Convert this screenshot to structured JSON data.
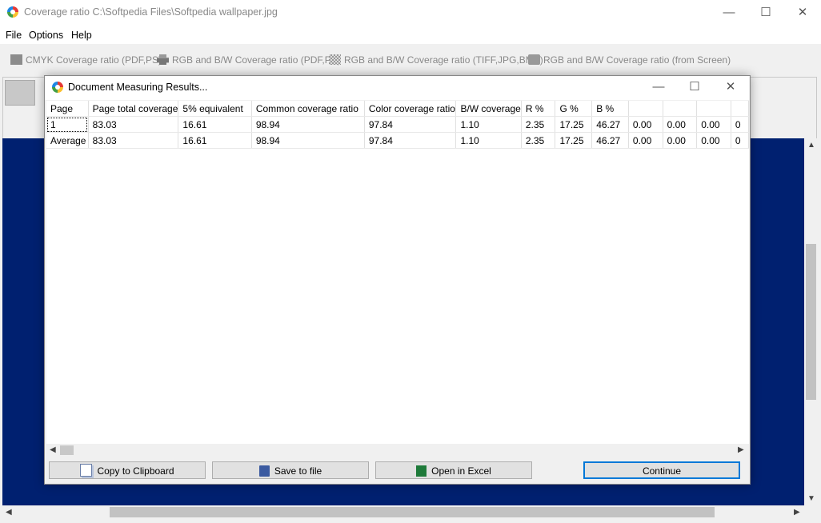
{
  "window": {
    "title": "Coverage ratio  C:\\Softpedia Files\\Softpedia wallpaper.jpg",
    "minimize": "—",
    "maximize": "☐",
    "close": "✕"
  },
  "menu": [
    "File",
    "Options",
    "Help"
  ],
  "toolbar": [
    {
      "label": "CMYK Coverage ratio  (PDF,PS)",
      "icon": "cmyk-icon"
    },
    {
      "label": "RGB and B/W Coverage ratio (PDF,PS)",
      "icon": "printer-icon"
    },
    {
      "label": "RGB and B/W Coverage ratio (TIFF,JPG,BMP)",
      "icon": "checker-icon"
    },
    {
      "label": "RGB and B/W Coverage ratio (from Screen)",
      "icon": "monitor-icon"
    }
  ],
  "dialog": {
    "title": "Document Measuring Results...",
    "minimize": "—",
    "maximize": "☐",
    "close": "✕",
    "columns": [
      "Page",
      "Page total coverage",
      "5% equivalent",
      "Common coverage ratio",
      "Color coverage ratio",
      "B/W coverage",
      "R %",
      "G %",
      "B %",
      "",
      "",
      "",
      ""
    ],
    "rows": [
      [
        "1",
        "83.03",
        "16.61",
        "98.94",
        "97.84",
        "1.10",
        "2.35",
        "17.25",
        "46.27",
        "0.00",
        "0.00",
        "0.00",
        "0"
      ],
      [
        "Average",
        "83.03",
        "16.61",
        "98.94",
        "97.84",
        "1.10",
        "2.35",
        "17.25",
        "46.27",
        "0.00",
        "0.00",
        "0.00",
        "0"
      ]
    ],
    "buttons": {
      "copy": "Copy to Clipboard",
      "save": "Save to file",
      "excel": "Open in Excel",
      "continue": "Continue"
    }
  },
  "colors": {
    "canvas_blue": "#002070",
    "accent": "#0078d7"
  }
}
